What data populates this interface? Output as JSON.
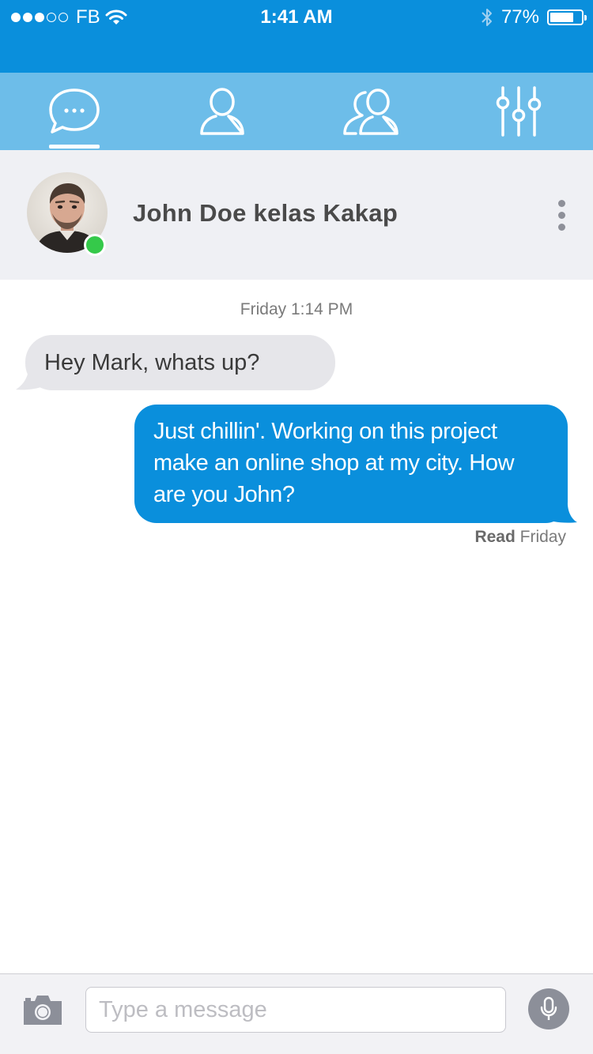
{
  "status_bar": {
    "carrier": "FB",
    "time": "1:41 AM",
    "battery_text": "77%",
    "battery_level": 0.77,
    "signal_bars_filled": 3,
    "signal_bars_total": 5
  },
  "tabs": [
    {
      "name": "chats",
      "icon": "chat-bubble-icon",
      "active": true
    },
    {
      "name": "profile",
      "icon": "user-icon",
      "active": false
    },
    {
      "name": "groups",
      "icon": "users-icon",
      "active": false
    },
    {
      "name": "settings",
      "icon": "sliders-icon",
      "active": false
    }
  ],
  "contact": {
    "name": "John Doe kelas Kakap",
    "online": true
  },
  "conversation": {
    "timestamp": "Friday 1:14 PM",
    "messages": [
      {
        "direction": "incoming",
        "text": "Hey Mark, whats up?"
      },
      {
        "direction": "outgoing",
        "text": "Just chillin'. Working on this project make an online shop at my city. How are you John?"
      }
    ],
    "read_label": "Read",
    "read_time": "Friday"
  },
  "composer": {
    "placeholder": "Type a message",
    "value": ""
  },
  "colors": {
    "header_blue": "#0a8fdc",
    "tab_bar_blue": "#6dbde9",
    "incoming_bubble": "#e6e6ea",
    "outgoing_bubble": "#0a8fdc",
    "online_green": "#35c94a"
  }
}
